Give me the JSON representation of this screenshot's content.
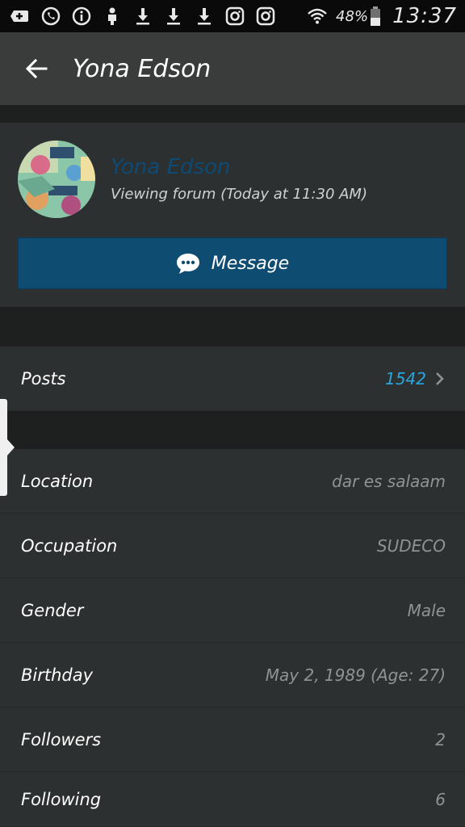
{
  "status_bar": {
    "battery_percent": "48%",
    "time": "13:37",
    "icons": [
      "plus-box-icon",
      "whatsapp-icon",
      "info-icon",
      "android-icon",
      "download-icon",
      "download-icon",
      "download-icon",
      "instagram-icon",
      "instagram-icon",
      "wifi-icon",
      "battery-icon"
    ]
  },
  "app_bar": {
    "title": "Yona Edson",
    "back_icon": "arrow-left-icon"
  },
  "profile": {
    "name": "Yona Edson",
    "status": "Viewing forum (Today at 11:30 AM)",
    "message_button": "Message",
    "name_color": "#0d4a74",
    "button_color": "#0f4c72"
  },
  "stats": {
    "posts_label": "Posts",
    "posts_value": "1542",
    "posts_color": "#29a6de"
  },
  "details": [
    {
      "label": "Location",
      "value": "dar es salaam"
    },
    {
      "label": "Occupation",
      "value": "SUDECO"
    },
    {
      "label": "Gender",
      "value": "Male"
    },
    {
      "label": "Birthday",
      "value": "May 2, 1989 (Age: 27)"
    },
    {
      "label": "Followers",
      "value": "2"
    },
    {
      "label": "Following",
      "value": "6"
    }
  ]
}
